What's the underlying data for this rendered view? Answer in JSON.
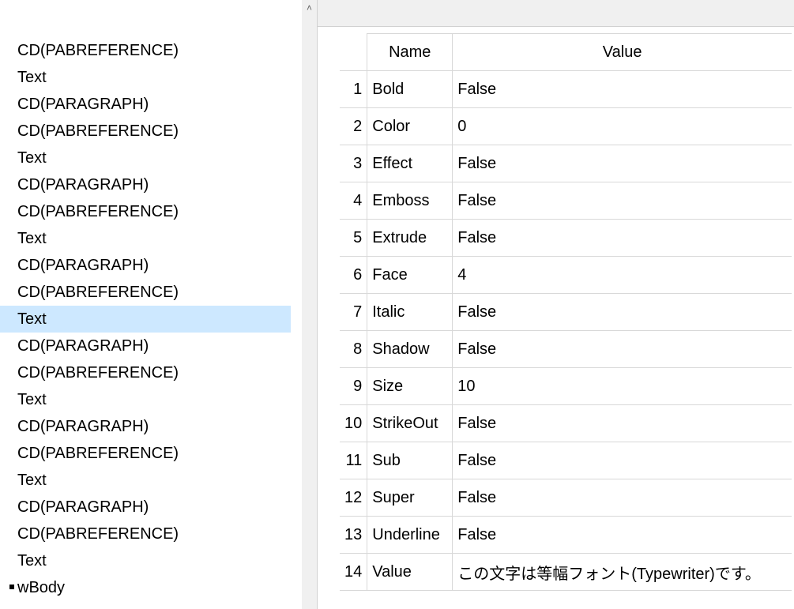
{
  "tree": {
    "items": [
      {
        "label": "CD(PABREFERENCE)",
        "selected": false
      },
      {
        "label": "Text",
        "selected": false
      },
      {
        "label": "CD(PARAGRAPH)",
        "selected": false
      },
      {
        "label": "CD(PABREFERENCE)",
        "selected": false
      },
      {
        "label": "Text",
        "selected": false
      },
      {
        "label": "CD(PARAGRAPH)",
        "selected": false
      },
      {
        "label": "CD(PABREFERENCE)",
        "selected": false
      },
      {
        "label": "Text",
        "selected": false
      },
      {
        "label": "CD(PARAGRAPH)",
        "selected": false
      },
      {
        "label": "CD(PABREFERENCE)",
        "selected": false
      },
      {
        "label": "Text",
        "selected": true
      },
      {
        "label": "CD(PARAGRAPH)",
        "selected": false
      },
      {
        "label": "CD(PABREFERENCE)",
        "selected": false
      },
      {
        "label": "Text",
        "selected": false
      },
      {
        "label": "CD(PARAGRAPH)",
        "selected": false
      },
      {
        "label": "CD(PABREFERENCE)",
        "selected": false
      },
      {
        "label": "Text",
        "selected": false
      },
      {
        "label": "CD(PARAGRAPH)",
        "selected": false
      },
      {
        "label": "CD(PABREFERENCE)",
        "selected": false
      },
      {
        "label": "Text",
        "selected": false
      },
      {
        "label": "wBody",
        "selected": false,
        "bullet": true
      }
    ]
  },
  "grid": {
    "headers": {
      "name": "Name",
      "value": "Value"
    },
    "rows": [
      {
        "n": "1",
        "name": "Bold",
        "value": "False"
      },
      {
        "n": "2",
        "name": "Color",
        "value": "0"
      },
      {
        "n": "3",
        "name": "Effect",
        "value": "False"
      },
      {
        "n": "4",
        "name": "Emboss",
        "value": "False"
      },
      {
        "n": "5",
        "name": "Extrude",
        "value": "False"
      },
      {
        "n": "6",
        "name": "Face",
        "value": "4"
      },
      {
        "n": "7",
        "name": "Italic",
        "value": "False"
      },
      {
        "n": "8",
        "name": "Shadow",
        "value": "False"
      },
      {
        "n": "9",
        "name": "Size",
        "value": "10"
      },
      {
        "n": "10",
        "name": "StrikeOut",
        "value": "False"
      },
      {
        "n": "11",
        "name": "Sub",
        "value": "False"
      },
      {
        "n": "12",
        "name": "Super",
        "value": "False"
      },
      {
        "n": "13",
        "name": "Underline",
        "value": "False"
      },
      {
        "n": "14",
        "name": "Value",
        "value": "この文字は等幅フォント(Typewriter)です。"
      }
    ]
  },
  "icons": {
    "scroll_up_glyph": "˄"
  }
}
